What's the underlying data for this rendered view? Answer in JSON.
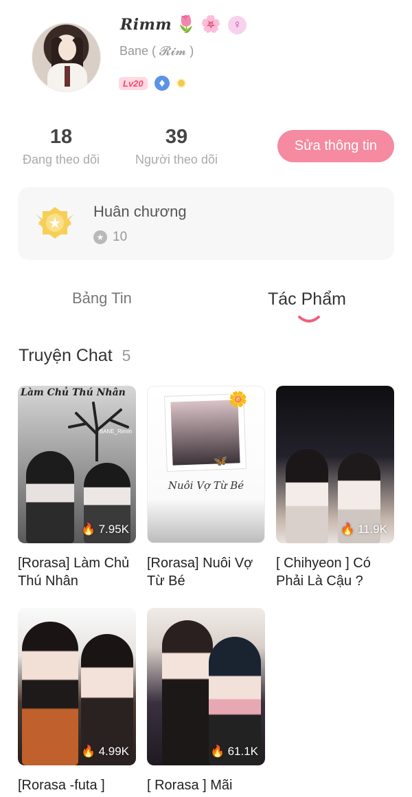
{
  "profile": {
    "nickname": "Rimm",
    "nickname_emojis": [
      "🌷",
      "🌸"
    ],
    "gender_icon": "♀",
    "sub_name": "Bane ( 𝓡𝓲𝓶 )",
    "level_badge": "Lv20"
  },
  "stats": {
    "following_count": "18",
    "following_label": "Đang theo dõi",
    "followers_count": "39",
    "followers_label": "Người theo dõi"
  },
  "edit_button_label": "Sửa thông tin",
  "medal": {
    "title": "Huân chương",
    "count": "10"
  },
  "tabs": [
    {
      "label": "Bảng Tin",
      "active": false
    },
    {
      "label": "Tác Phẩm",
      "active": true
    }
  ],
  "section": {
    "title": "Truyện Chat",
    "count": "5"
  },
  "works": [
    {
      "title": "[Rorasa] Làm Chủ Thú Nhân",
      "views": "7.95K",
      "cover_text": "Làm Chủ Thú Nhân",
      "watermark": "BANE_Rimm"
    },
    {
      "title": "[Rorasa] Nuôi Vợ Từ Bé",
      "views": "",
      "cover_text": "Nuôi Vợ Từ Bé"
    },
    {
      "title": "[ Chihyeon ] Có Phải Là Cậu ?",
      "views": "11.9K"
    },
    {
      "title": "[Rorasa -futa ]",
      "views": "4.99K"
    },
    {
      "title": "[ Rorasa ] Mãi",
      "views": "61.1K"
    }
  ],
  "colors": {
    "accent_pink": "#f58aa0",
    "level_text": "#f04a6d"
  }
}
